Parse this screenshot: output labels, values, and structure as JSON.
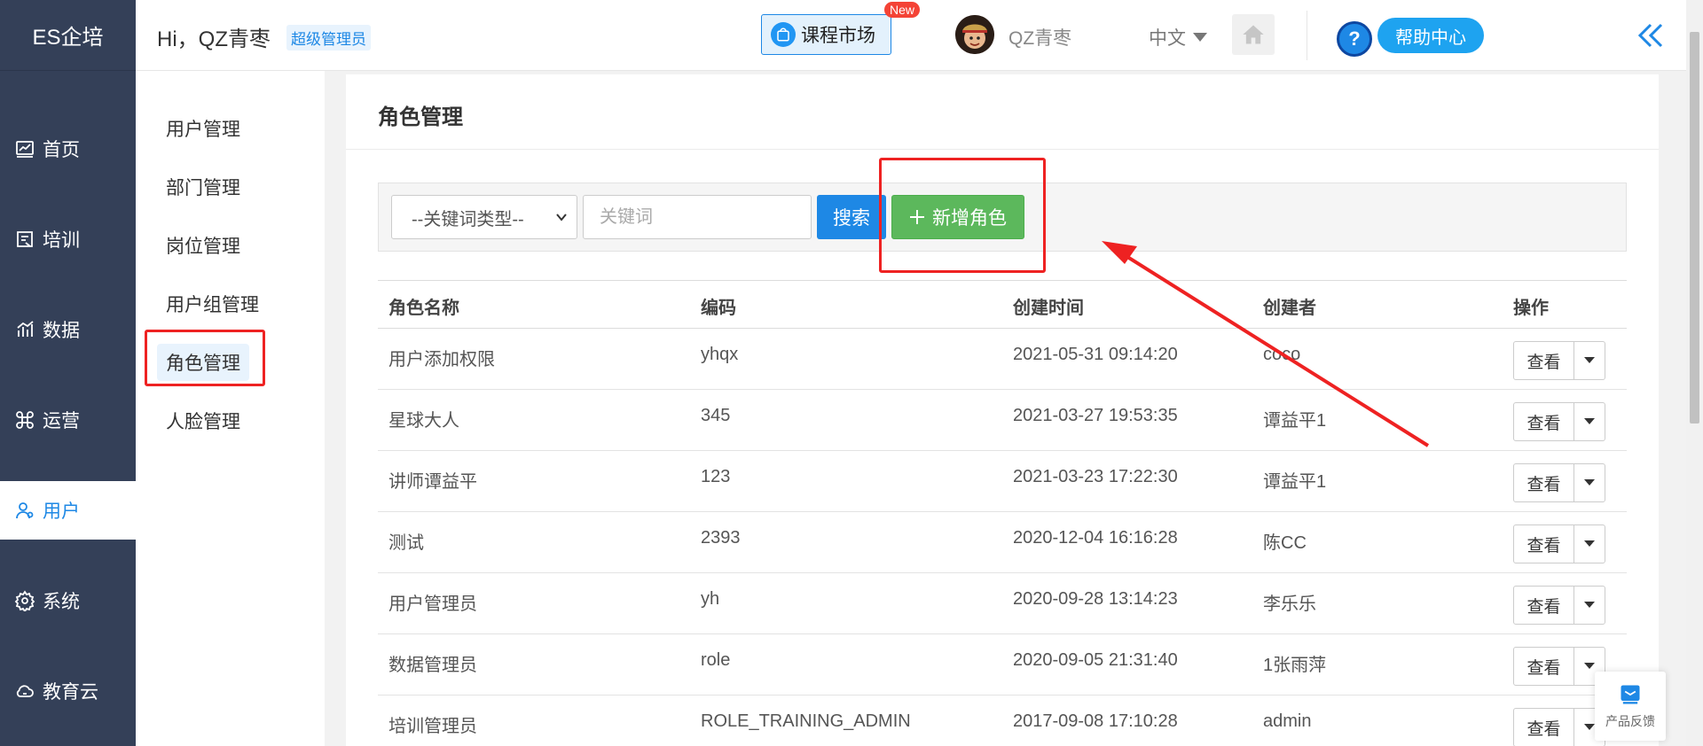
{
  "brand": "ES企培",
  "sidebar": {
    "items": [
      {
        "label": "首页",
        "icon": "chart-icon"
      },
      {
        "label": "培训",
        "icon": "training-icon"
      },
      {
        "label": "数据",
        "icon": "bar-chart-icon"
      },
      {
        "label": "运营",
        "icon": "command-icon"
      },
      {
        "label": "用户",
        "icon": "user-icon",
        "active": true
      },
      {
        "label": "系统",
        "icon": "gear-icon"
      },
      {
        "label": "教育云",
        "icon": "cloud-icon"
      }
    ]
  },
  "submenu": {
    "items": [
      {
        "label": "用户管理"
      },
      {
        "label": "部门管理"
      },
      {
        "label": "岗位管理"
      },
      {
        "label": "用户组管理"
      },
      {
        "label": "角色管理",
        "active": true
      },
      {
        "label": "人脸管理"
      }
    ]
  },
  "header": {
    "greeting": "Hi，QZ青枣",
    "role_tag": "超级管理员",
    "course_market": "课程市场",
    "new_badge": "New",
    "username": "QZ青枣",
    "language": "中文",
    "help": "帮助中心"
  },
  "page": {
    "title": "角色管理",
    "keyword_type_select": "--关键词类型--",
    "keyword_placeholder": "关键词",
    "search_label": "搜索",
    "add_role_label": "新增角色"
  },
  "table": {
    "columns": [
      "角色名称",
      "编码",
      "创建时间",
      "创建者",
      "操作"
    ],
    "view_label": "查看",
    "rows": [
      {
        "name": "用户添加权限",
        "code": "yhqx",
        "created": "2021-05-31 09:14:20",
        "creator": "coco"
      },
      {
        "name": "星球大人",
        "code": "345",
        "created": "2021-03-27 19:53:35",
        "creator": "谭益平1"
      },
      {
        "name": "讲师谭益平",
        "code": "123",
        "created": "2021-03-23 17:22:30",
        "creator": "谭益平1"
      },
      {
        "name": "测试",
        "code": "2393",
        "created": "2020-12-04 16:16:28",
        "creator": "陈CC"
      },
      {
        "name": "用户管理员",
        "code": "yh",
        "created": "2020-09-28 13:14:23",
        "creator": "李乐乐"
      },
      {
        "name": "数据管理员",
        "code": "role",
        "created": "2020-09-05 21:31:40",
        "creator": "1张雨萍"
      },
      {
        "name": "培训管理员",
        "code": "ROLE_TRAINING_ADMIN",
        "created": "2017-09-08 17:10:28",
        "creator": "admin"
      }
    ]
  },
  "feedback": "产品反馈",
  "colors": {
    "sidebar_bg": "#344058",
    "primary": "#1e88e5",
    "success": "#5cb85c",
    "annotation_red": "#ee2222"
  }
}
